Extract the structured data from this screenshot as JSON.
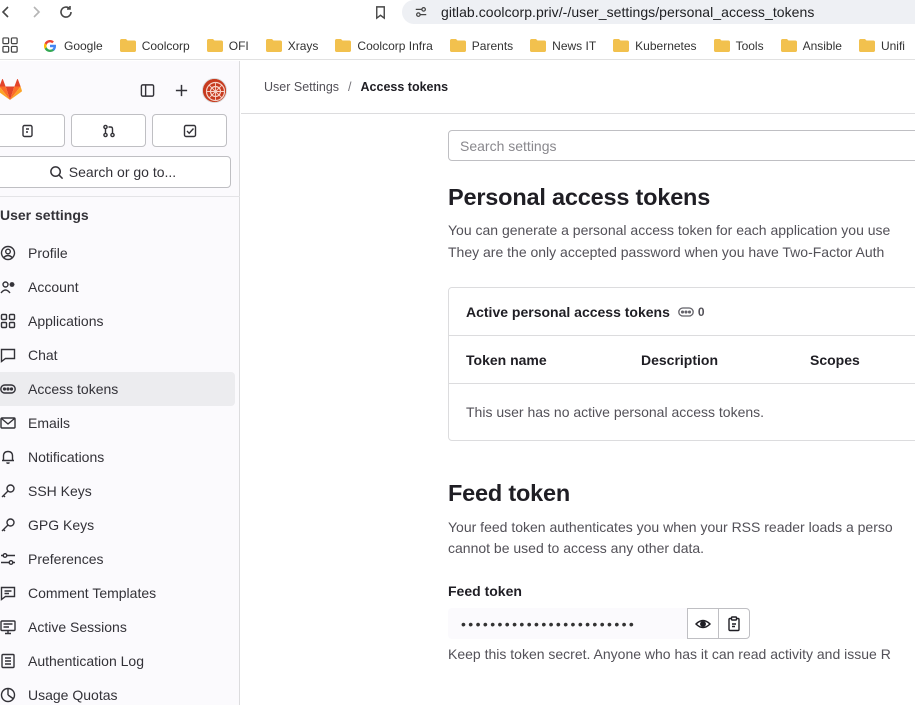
{
  "browser": {
    "url": "gitlab.coolcorp.priv/-/user_settings/personal_access_tokens",
    "bookmarks": [
      "Google",
      "Coolcorp",
      "OFI",
      "Xrays",
      "Coolcorp Infra",
      "Parents",
      "News IT",
      "Kubernetes",
      "Tools",
      "Ansible",
      "Unifi"
    ],
    "folder_color": "#f2c14e"
  },
  "sidebar": {
    "search_label": "Search or go to...",
    "section_title": "User settings",
    "items": [
      {
        "label": "Profile",
        "icon": "profile-icon"
      },
      {
        "label": "Account",
        "icon": "account-icon"
      },
      {
        "label": "Applications",
        "icon": "applications-icon"
      },
      {
        "label": "Chat",
        "icon": "chat-icon"
      },
      {
        "label": "Access tokens",
        "icon": "token-icon",
        "active": true
      },
      {
        "label": "Emails",
        "icon": "mail-icon"
      },
      {
        "label": "Notifications",
        "icon": "bell-icon"
      },
      {
        "label": "SSH Keys",
        "icon": "key-icon"
      },
      {
        "label": "GPG Keys",
        "icon": "key-icon"
      },
      {
        "label": "Preferences",
        "icon": "preferences-icon"
      },
      {
        "label": "Comment Templates",
        "icon": "comment-icon"
      },
      {
        "label": "Active Sessions",
        "icon": "monitor-icon"
      },
      {
        "label": "Authentication Log",
        "icon": "log-icon"
      },
      {
        "label": "Usage Quotas",
        "icon": "quota-icon"
      }
    ]
  },
  "breadcrumb": {
    "parent": "User Settings",
    "separator": "/",
    "current": "Access tokens"
  },
  "main": {
    "search_placeholder": "Search settings",
    "title": "Personal access tokens",
    "desc_line1": "You can generate a personal access token for each application you use",
    "desc_line2": "They are the only accepted password when you have Two-Factor Auth",
    "card": {
      "title": "Active personal access tokens",
      "count": "0",
      "columns": [
        "Token name",
        "Description",
        "Scopes"
      ],
      "empty_text": "This user has no active personal access tokens."
    },
    "feed": {
      "title": "Feed token",
      "desc_line1": "Your feed token authenticates you when your RSS reader loads a perso",
      "desc_line2": "cannot be used to access any other data.",
      "label": "Feed token",
      "masked_value": "••••••••••••••••••••••••",
      "help": "Keep this token secret. Anyone who has it can read activity and issue R"
    }
  },
  "colors": {
    "gitlab_orange": "#e24329",
    "sidebar_bg": "#fbfafd",
    "active_item_bg": "#ececef"
  }
}
